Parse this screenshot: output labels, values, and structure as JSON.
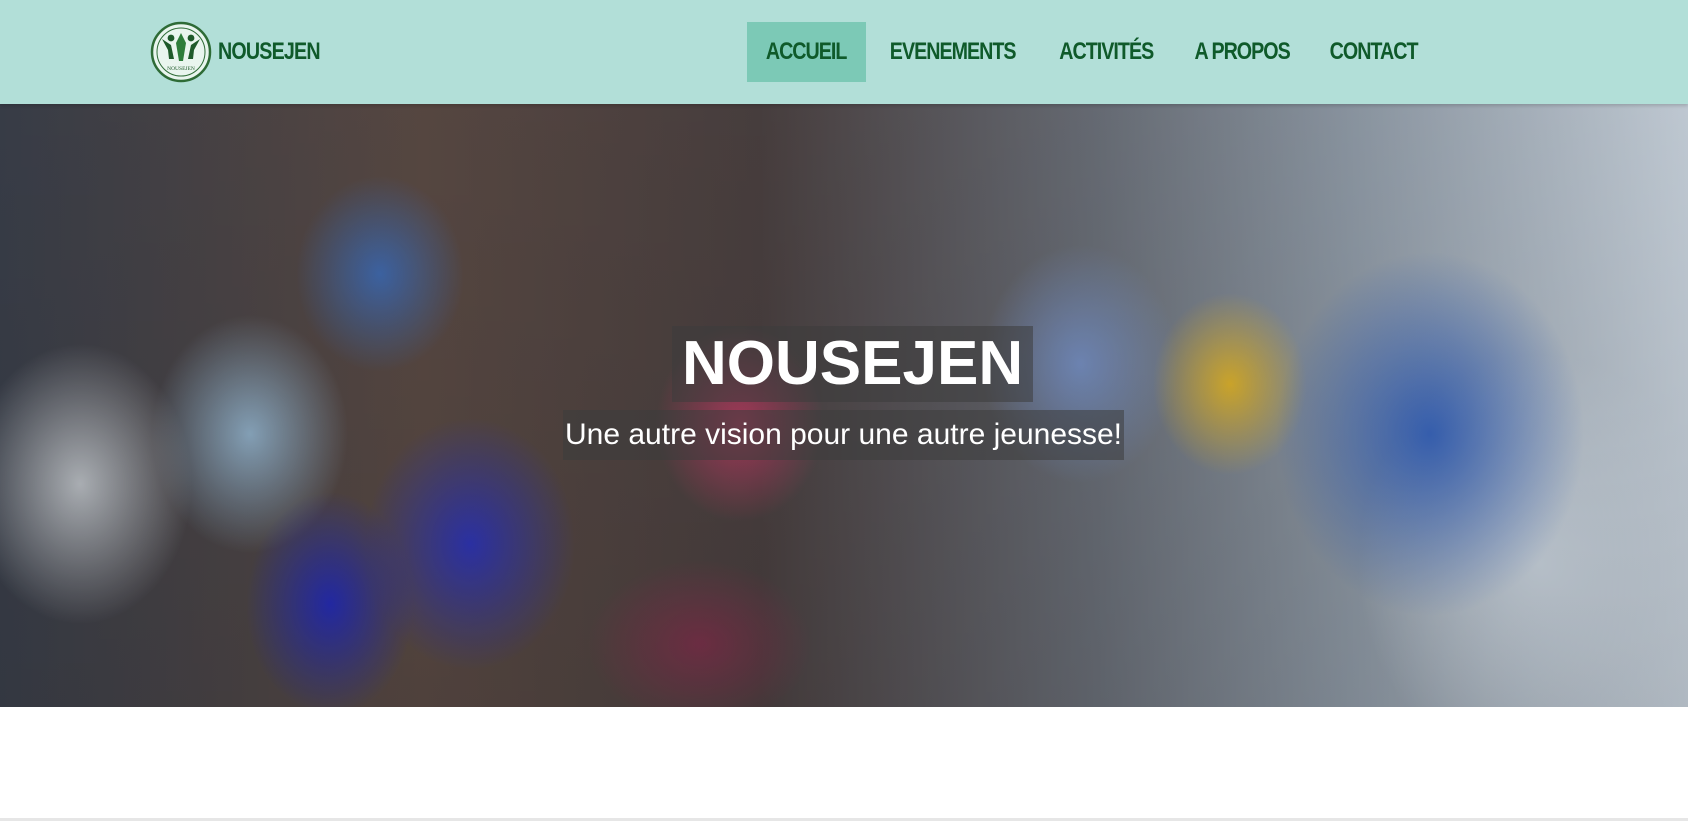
{
  "brand": {
    "name": "NOUSEJEN",
    "logo_icon": "nousejen-logo-icon",
    "logo_text": "NOUSEJEN"
  },
  "nav": {
    "items": [
      {
        "label": "ACCUEIL",
        "active": true
      },
      {
        "label": "EVENEMENTS",
        "active": false
      },
      {
        "label": "ACTIVITÉS",
        "active": false
      },
      {
        "label": "A PROPOS",
        "active": false
      },
      {
        "label": "CONTACT",
        "active": false
      }
    ]
  },
  "hero": {
    "title": "NOUSEJEN",
    "subtitle": "Une autre vision pour une autre jeunesse!"
  },
  "colors": {
    "navbar_bg": "#b2dfd8",
    "nav_active_bg": "#7cc9b6",
    "nav_text": "#0f5a2a"
  }
}
